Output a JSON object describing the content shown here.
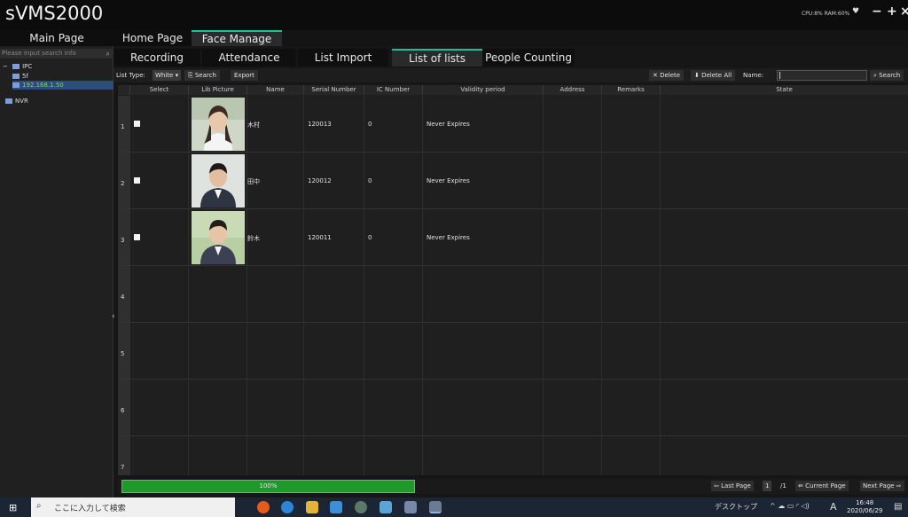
{
  "app": {
    "title": "sVMS2000",
    "sysinfo": "CPU:8% RAM:60%",
    "heart": "♥",
    "minimize": "−",
    "maximize": "+",
    "close": "×"
  },
  "main_tabs": [
    "Main Page",
    "Home Page",
    "Face Manage"
  ],
  "sidebar": {
    "search_placeholder": "Please input search info",
    "tree": [
      {
        "label": "IPC",
        "prefix": "−"
      },
      {
        "label": "5f"
      },
      {
        "label": "192.168.1.50"
      },
      {
        "label": "NVR"
      }
    ]
  },
  "sub_tabs": [
    "Recording",
    "Attendance",
    "List Import",
    "List of lists",
    "People Counting"
  ],
  "toolbar": {
    "list_type_label": "List Type:",
    "list_type_value": "White",
    "search_label": "Search",
    "export_label": "Export",
    "delete_label": "Delete",
    "delete_all_label": "Delete All",
    "name_label": "Name:",
    "search_right_label": "Search"
  },
  "table": {
    "headers": [
      "Select",
      "Lib Picture",
      "Name",
      "Serial Number",
      "IC Number",
      "Validity period",
      "Address",
      "Remarks",
      "State"
    ],
    "rows": [
      {
        "num": "1",
        "name": "木村",
        "serial": "120013",
        "ic": "0",
        "validity": "Never Expires"
      },
      {
        "num": "2",
        "name": "田中",
        "serial": "120012",
        "ic": "0",
        "validity": "Never Expires"
      },
      {
        "num": "3",
        "name": "鈴木",
        "serial": "120011",
        "ic": "0",
        "validity": "Never Expires"
      },
      {
        "num": "4"
      },
      {
        "num": "5"
      },
      {
        "num": "6"
      },
      {
        "num": "7"
      }
    ]
  },
  "footer": {
    "progress_text": "100%",
    "progress_value": 1.0,
    "last_page_label": "Last Page",
    "page_input": "1",
    "page_total": "/1",
    "current_page_label": "Current Page",
    "next_page_label": "Next Page"
  },
  "taskbar": {
    "search_text": "ここに入力して検索",
    "desktop_label": "デスクトップ",
    "ime": "A",
    "time": "16:48",
    "date": "2020/06/29"
  },
  "colors": {
    "accent": "#1bbf9a",
    "progress": "#1f9a2a",
    "selected_tree": "#7ad76c"
  }
}
